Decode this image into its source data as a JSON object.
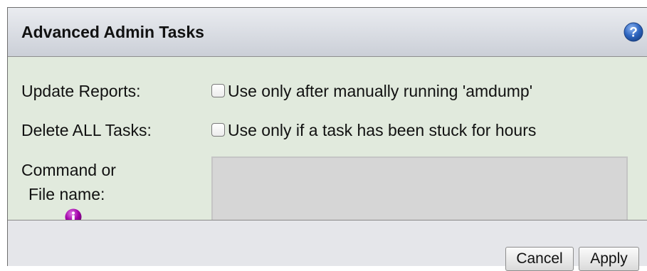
{
  "dialog": {
    "title": "Advanced Admin Tasks",
    "help_icon": "question-mark-icon"
  },
  "form": {
    "update_reports": {
      "label": "Update Reports:",
      "checkbox_text": "Use only after manually running 'amdump'",
      "checked": false
    },
    "delete_tasks": {
      "label": "Delete ALL Tasks:",
      "checkbox_text": "Use only if a task has been stuck for hours",
      "checked": false
    },
    "command": {
      "label_line1": "Command or",
      "label_line2": "File name:",
      "info_icon": "info-icon",
      "value": "",
      "placeholder": ""
    }
  },
  "buttons": {
    "cancel": "Cancel",
    "apply": "Apply"
  },
  "colors": {
    "content_bg": "#e1eadd",
    "info_icon": "#a100a8",
    "help_icon": "#2f66c1"
  }
}
